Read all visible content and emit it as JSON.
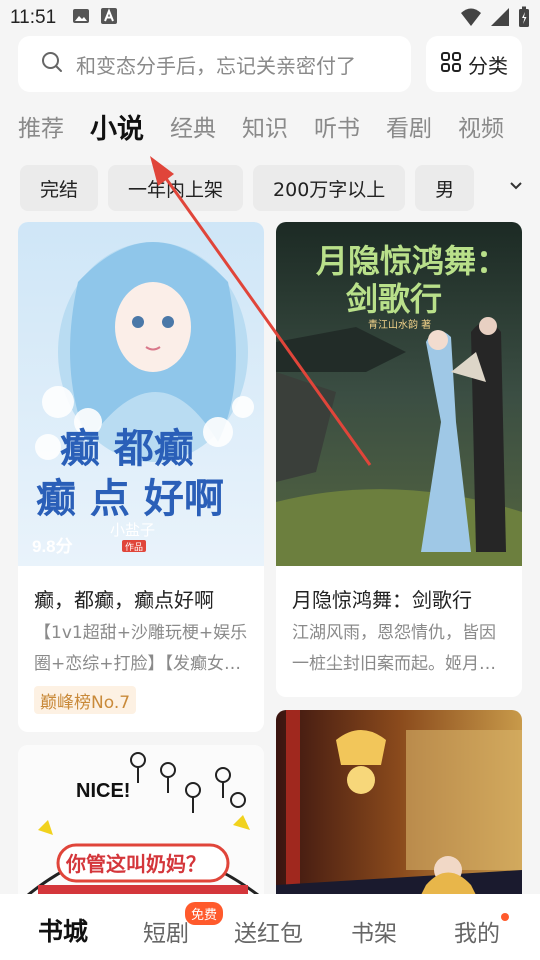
{
  "status": {
    "time": "11:51"
  },
  "search": {
    "placeholder": "和变态分手后，忘记关亲密付了"
  },
  "category_label": "分类",
  "tabs": [
    "推荐",
    "小说",
    "经典",
    "知识",
    "听书",
    "看剧",
    "视频"
  ],
  "filters": [
    "完结",
    "一年内上架",
    "200万字以上",
    "男"
  ],
  "cards": [
    {
      "title": "癫，都癫，癫点好啊",
      "desc": "【1v1超甜+沙雕玩梗+娱乐圈+恋综+打脸】【发癫女…",
      "rating": "9.8分",
      "badge": "巅峰榜No.7",
      "cover_text": [
        "癫 都癫",
        "癫 点 好啊",
        "小盐子",
        "作品"
      ]
    },
    {
      "title": "月隐惊鸿舞：剑歌行",
      "desc": "江湖风雨，恩怨情仇，皆因一桩尘封旧案而起。姬月…",
      "cover_text": [
        "月隐惊鸿舞：",
        "剑歌行",
        "青江山水韵 著"
      ]
    },
    {
      "cover_text": [
        "NICE!",
        "你管这叫奶妈？"
      ]
    },
    {
      "cover_text": []
    }
  ],
  "bottom_nav": [
    "书城",
    "短剧",
    "送红包",
    "书架",
    "我的"
  ],
  "free_badge": "免费",
  "colors": {
    "accent": "#ff5a2c",
    "annotation_arrow": "#e0453a",
    "badge_text": "#c98a3a"
  }
}
